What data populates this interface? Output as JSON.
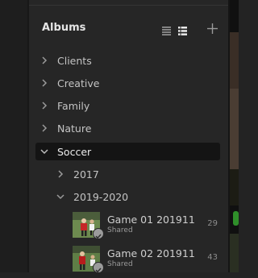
{
  "albums_panel": {
    "title": "Albums",
    "toolbar": {
      "list_view_icon": "list-view-icon",
      "grid_view_icon": "grid-view-icon",
      "add_icon": "plus-icon"
    },
    "items": [
      {
        "label": "Clients",
        "expanded": false
      },
      {
        "label": "Creative",
        "expanded": false
      },
      {
        "label": "Family",
        "expanded": false
      },
      {
        "label": "Nature",
        "expanded": false
      },
      {
        "label": "Soccer",
        "expanded": true,
        "selected": true,
        "children": [
          {
            "label": "2017",
            "expanded": false
          },
          {
            "label": "2019-2020",
            "expanded": true,
            "albums": [
              {
                "name": "Game 01 201911...",
                "status": "Shared",
                "count": "29"
              },
              {
                "name": "Game 02 201911...",
                "status": "Shared",
                "count": "43"
              }
            ]
          }
        ]
      }
    ]
  },
  "colors": {
    "panel_bg": "#262626",
    "selected_bg": "#141414",
    "text": "#c4c4c4",
    "heading": "#e6e6e6"
  }
}
